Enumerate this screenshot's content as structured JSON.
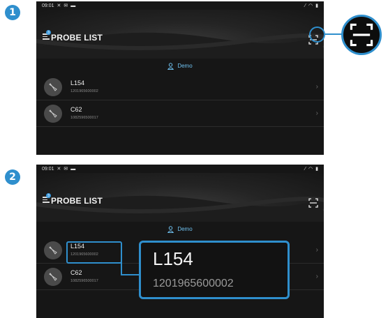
{
  "steps": [
    "1",
    "2"
  ],
  "statusbar": {
    "time": "09:01"
  },
  "header": {
    "title": "PROBE LIST",
    "menu_badge": "3"
  },
  "demo": {
    "label": "Demo"
  },
  "probes": [
    {
      "name": "L154",
      "serial": "1201965600002"
    },
    {
      "name": "C62",
      "serial": "1082596500017"
    }
  ],
  "callout": {
    "name": "L154",
    "serial": "1201965600002"
  },
  "colors": {
    "accent": "#2f8fcd",
    "background": "#161616",
    "demo_text": "#6fc1f0"
  }
}
